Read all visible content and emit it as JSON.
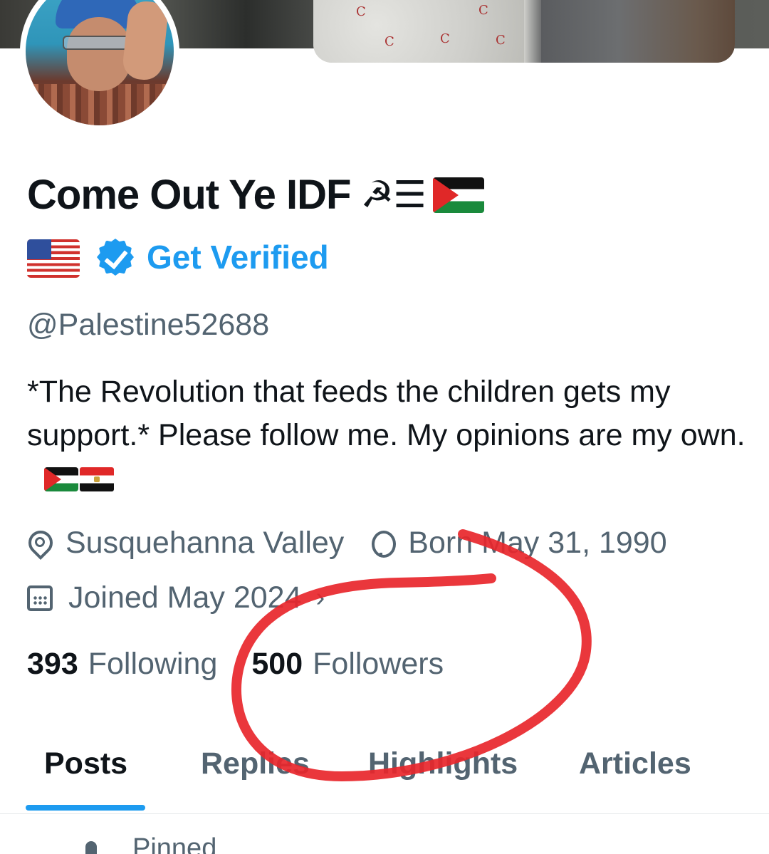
{
  "profile": {
    "name": "Come Out Ye IDF",
    "name_emoji": "☭☰",
    "verify_label": "Get Verified",
    "handle": "@Palestine52688",
    "bio": "*The Revolution that feeds the children gets my support.*  Please follow me.   My opinions are my own.",
    "location": "Susquehanna Valley",
    "birthday": "Born May 31, 1990",
    "joined": "Joined May 2024",
    "following_count": "393",
    "following_label": "Following",
    "followers_count": "500",
    "followers_label": "Followers"
  },
  "tabs": [
    {
      "label": "Posts"
    },
    {
      "label": "Replies"
    },
    {
      "label": "Highlights"
    },
    {
      "label": "Articles"
    }
  ],
  "pinned_label": "Pinned",
  "icons": {
    "location": "map-pin-icon",
    "birthday": "balloon-icon",
    "joined": "calendar-icon",
    "verified": "verified-badge-icon",
    "chevron": "chevron-right-icon"
  },
  "colors": {
    "accent": "#1d9bf0",
    "text": "#0f1419",
    "secondary": "#536471",
    "annotation": "#e8262b"
  }
}
